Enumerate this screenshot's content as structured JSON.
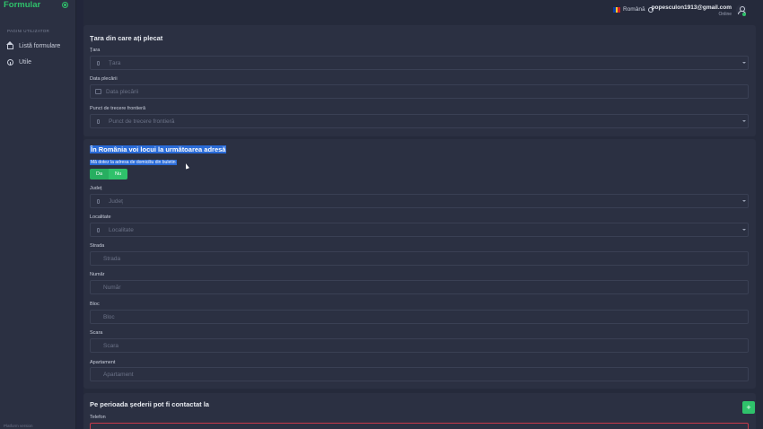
{
  "sidebar": {
    "brand": "Formular",
    "section_title": "PAGINI UTILIZATOR",
    "items": [
      {
        "label": "Listă formulare",
        "icon": "home-icon"
      },
      {
        "label": "Utile",
        "icon": "info-icon"
      }
    ],
    "footer": "Platform version"
  },
  "header": {
    "language": "Română",
    "email": "popesculon1913@gmail.com",
    "status": "Online"
  },
  "departure": {
    "title": "Țara din care ați plecat",
    "country_label": "Țara",
    "country_placeholder": "Țara",
    "date_label": "Data plecării",
    "date_placeholder": "Data plecării",
    "border_label": "Punct de trecere frontieră",
    "border_placeholder": "Punct de trecere frontieră"
  },
  "address": {
    "title": "În România voi locui la următoarea adresă",
    "same_as_id": "Mă dotez la adresa de domiciliu din buletin",
    "yes": "Da",
    "no": "Nu",
    "county_label": "Județ",
    "county_placeholder": "Județ",
    "locality_label": "Localitate",
    "locality_placeholder": "Localitate",
    "street_label": "Strada",
    "street_placeholder": "Strada",
    "number_label": "Număr",
    "number_placeholder": "Număr",
    "block_label": "Bloc",
    "block_placeholder": "Bloc",
    "staircase_label": "Scara",
    "staircase_placeholder": "Scara",
    "apartment_label": "Apartament",
    "apartment_placeholder": "Apartament"
  },
  "contact": {
    "title": "Pe perioada șederii pot fi contactat la",
    "phone_label": "Telefon",
    "add_label": "+"
  },
  "colors": {
    "accent": "#2fc16b",
    "selection": "#2a6bd8",
    "error_border": "#c7394a"
  }
}
